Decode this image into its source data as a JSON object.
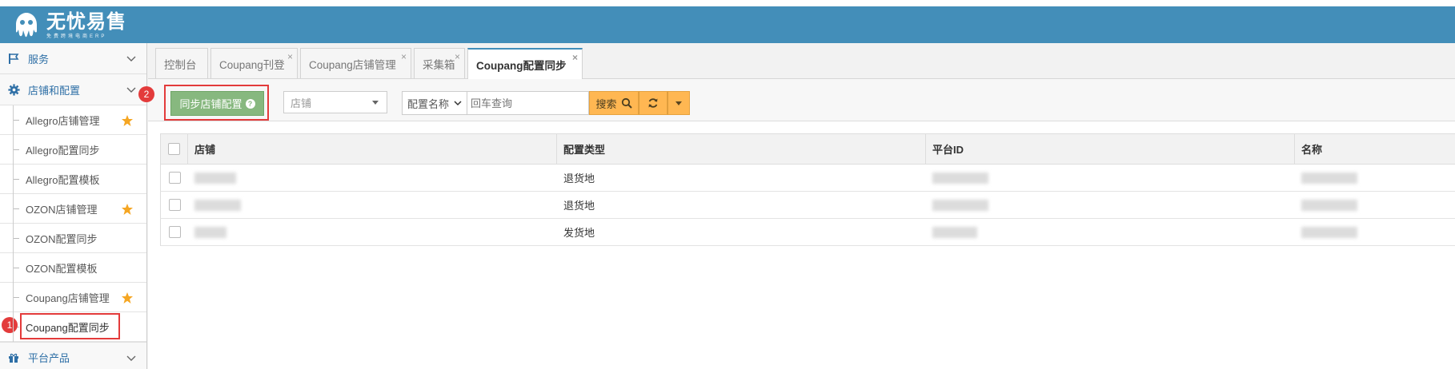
{
  "header": {
    "logo_title": "无忧易售",
    "logo_subtitle": "免费跨境电商ERP",
    "bg_color": "#438eb9"
  },
  "sidebar": {
    "groups": [
      {
        "label": "服务",
        "icon": "flag-icon"
      },
      {
        "label": "店铺和配置",
        "icon": "gear-icon"
      },
      {
        "label": "平台产品",
        "icon": "gift-icon"
      }
    ],
    "items": [
      {
        "label": "Allegro店铺管理",
        "starred": true
      },
      {
        "label": "Allegro配置同步",
        "starred": false
      },
      {
        "label": "Allegro配置模板",
        "starred": false
      },
      {
        "label": "OZON店铺管理",
        "starred": true
      },
      {
        "label": "OZON配置同步",
        "starred": false
      },
      {
        "label": "OZON配置模板",
        "starred": false
      },
      {
        "label": "Coupang店铺管理",
        "starred": true
      },
      {
        "label": "Coupang配置同步",
        "starred": false,
        "active": true
      }
    ],
    "badge_1": "1"
  },
  "tabs": [
    {
      "label": "控制台",
      "closable": false
    },
    {
      "label": "Coupang刊登",
      "closable": true
    },
    {
      "label": "Coupang店铺管理",
      "closable": true
    },
    {
      "label": "采集箱",
      "closable": true
    },
    {
      "label": "Coupang配置同步",
      "closable": true,
      "active": true
    }
  ],
  "tab_close_glyph": "×",
  "toolbar": {
    "sync_button": "同步店铺配置",
    "help_glyph": "?",
    "badge_2": "2",
    "shop_select_placeholder": "店铺",
    "field_select_value": "配置名称",
    "search_placeholder": "回车查询",
    "search_button": "搜索"
  },
  "table": {
    "columns": [
      "店铺",
      "配置类型",
      "平台ID",
      "名称"
    ],
    "rows": [
      {
        "type": "退货地"
      },
      {
        "type": "退货地"
      },
      {
        "type": "发货地"
      }
    ]
  },
  "colors": {
    "accent": "#438eb9",
    "green_button": "#87b87f",
    "yellow_button": "#ffb752",
    "highlight_red": "#e33b3b",
    "star": "#f5a623"
  }
}
